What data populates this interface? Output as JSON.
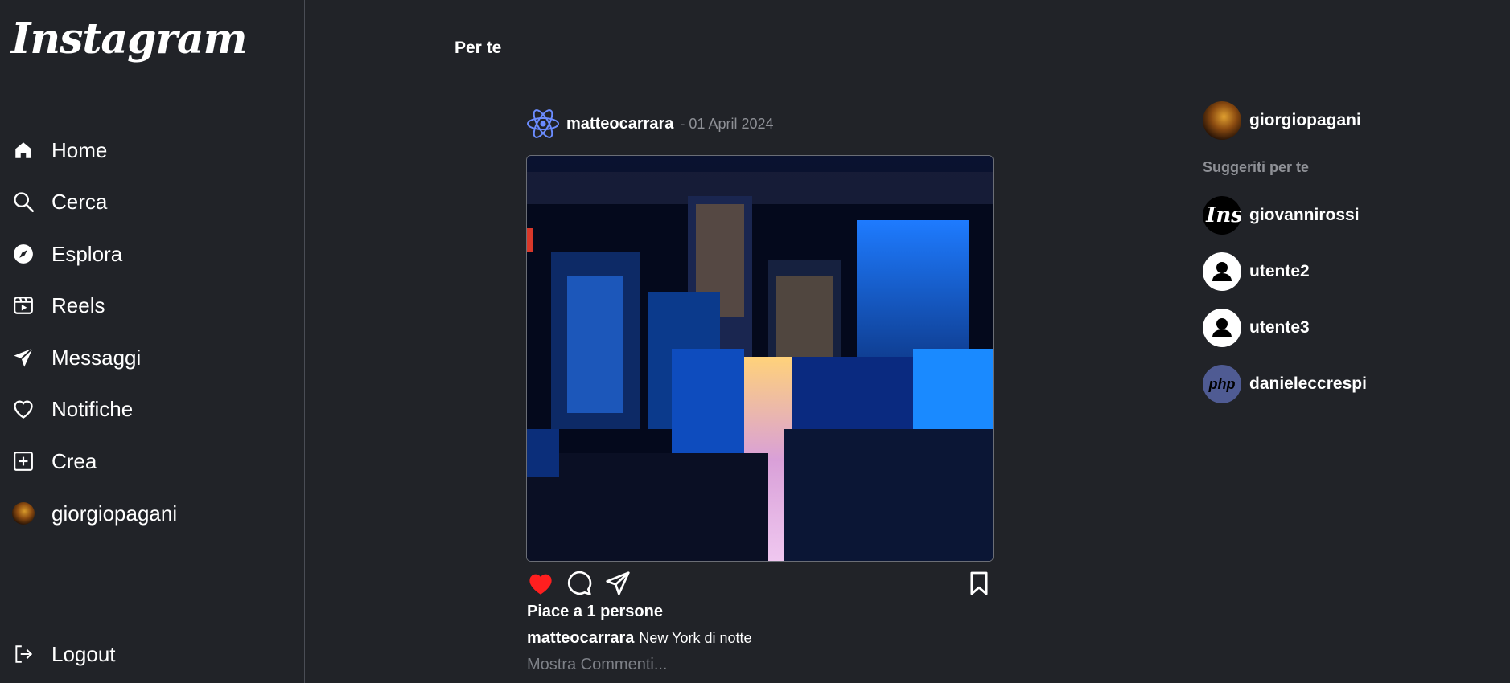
{
  "app": {
    "logo": "Instagram"
  },
  "sidebar": {
    "items": [
      {
        "label": "Home",
        "icon": "home-icon"
      },
      {
        "label": "Cerca",
        "icon": "search-icon"
      },
      {
        "label": "Esplora",
        "icon": "compass-icon"
      },
      {
        "label": "Reels",
        "icon": "reels-icon"
      },
      {
        "label": "Messaggi",
        "icon": "send-icon"
      },
      {
        "label": "Notifiche",
        "icon": "heart-icon"
      },
      {
        "label": "Crea",
        "icon": "plus-square-icon"
      },
      {
        "label": "giorgiopagani",
        "icon": "avatar"
      }
    ],
    "logout": {
      "label": "Logout",
      "icon": "logout-icon"
    }
  },
  "feed": {
    "title": "Per te",
    "post": {
      "username": "matteocarrara",
      "date": "- 01 April 2024",
      "likes": "Piace a 1 persone",
      "caption_user": "matteocarrara",
      "caption_text": "New York di notte",
      "comments_link": "Mostra Commenti...",
      "liked": true,
      "like_color": "#ff1f1f"
    }
  },
  "right": {
    "current_user": "giorgiopagani",
    "suggested_title": "Suggeriti per te",
    "suggested": [
      {
        "name": "giovannirossi",
        "avatar": "instagram-logo-avatar",
        "avatar_text": "Ins"
      },
      {
        "name": "utente2",
        "avatar": "default-user-avatar"
      },
      {
        "name": "utente3",
        "avatar": "default-user-avatar"
      },
      {
        "name": "danieleccrespi",
        "avatar": "php-logo-avatar",
        "avatar_text": "php"
      }
    ]
  }
}
